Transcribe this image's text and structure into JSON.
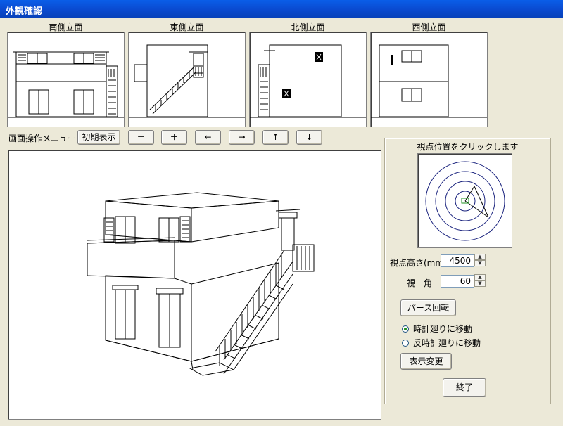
{
  "window": {
    "title": "外観確認"
  },
  "elevations": [
    {
      "label": "南側立面"
    },
    {
      "label": "東側立面"
    },
    {
      "label": "北側立面"
    },
    {
      "label": "西側立面"
    }
  ],
  "toolbar": {
    "menu_label": "画面操作メニュー",
    "reset_label": "初期表示",
    "zoom_out_label": "－",
    "zoom_in_label": "＋",
    "left_label": "←",
    "right_label": "→",
    "up_label": "↑",
    "down_label": "↓"
  },
  "viewpoint": {
    "instruction": "視点位置をクリックします",
    "height_label": "視点高さ(mm)",
    "height_value": "4500",
    "angle_label": "視　角",
    "angle_value": "60",
    "perspective_button": "パース回転",
    "cw_label": "時計廻りに移動",
    "ccw_label": "反時計廻りに移動",
    "selected_direction": "clockwise",
    "apply_button": "表示変更",
    "exit_button": "終了"
  }
}
